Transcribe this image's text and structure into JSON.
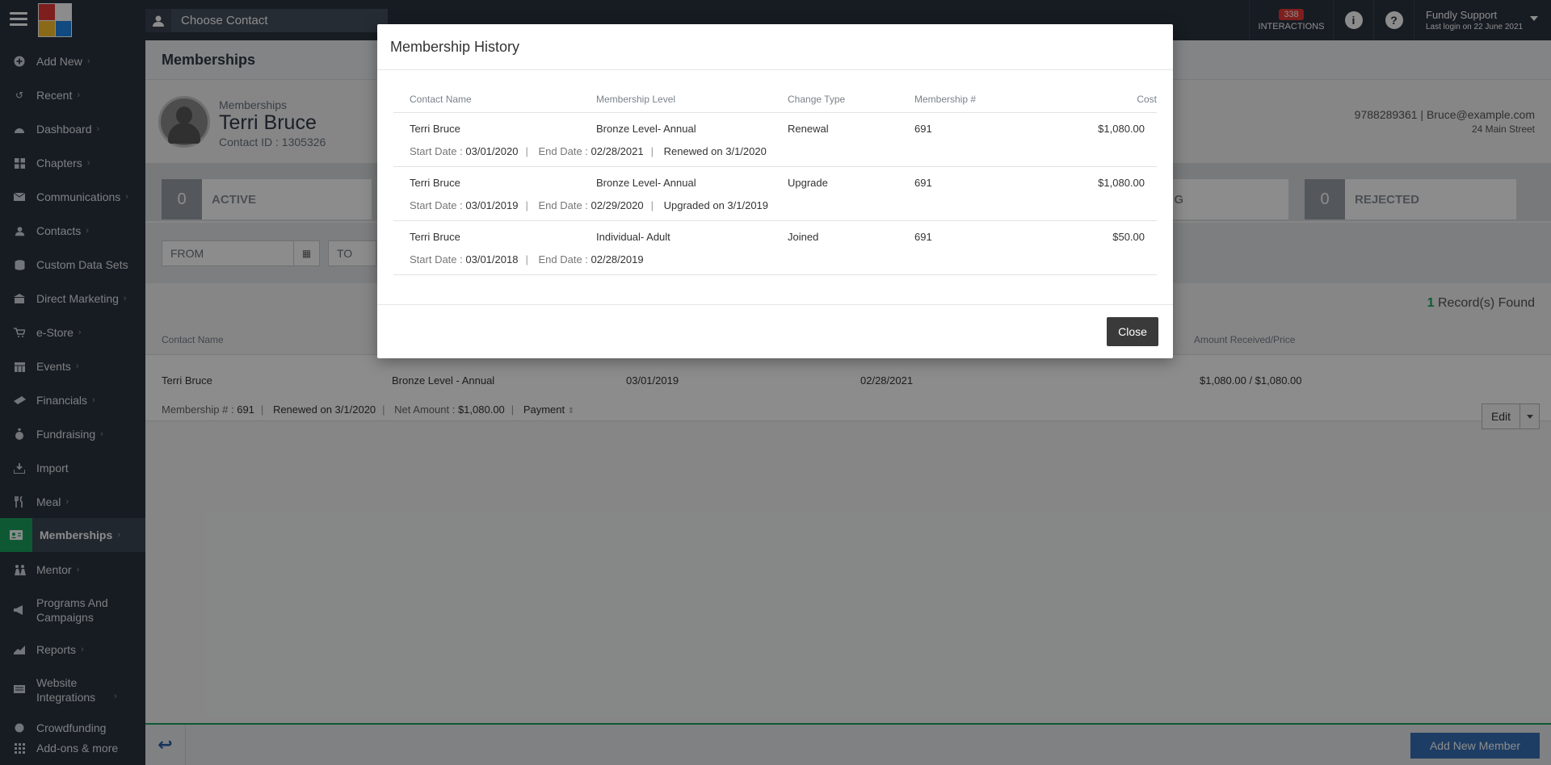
{
  "topbar": {
    "contact_picker_label": "Choose Contact",
    "interactions_count": "338",
    "interactions_label": "INTERACTIONS",
    "user_name": "Fundly Support",
    "last_login": "Last login on 22 June 2021"
  },
  "sidebar": {
    "items": [
      {
        "label": "Add New",
        "icon": "plus-circle-icon"
      },
      {
        "label": "Recent",
        "icon": "history-icon"
      },
      {
        "label": "Dashboard",
        "icon": "dashboard-icon"
      },
      {
        "label": "Chapters",
        "icon": "grid-icon"
      },
      {
        "label": "Communications",
        "icon": "envelope-icon"
      },
      {
        "label": "Contacts",
        "icon": "user-icon"
      },
      {
        "label": "Custom Data Sets",
        "icon": "database-icon"
      },
      {
        "label": "Direct Marketing",
        "icon": "building-icon"
      },
      {
        "label": "e-Store",
        "icon": "cart-icon"
      },
      {
        "label": "Events",
        "icon": "calendar-icon"
      },
      {
        "label": "Financials",
        "icon": "ticket-icon"
      },
      {
        "label": "Fundraising",
        "icon": "money-bag-icon"
      },
      {
        "label": "Import",
        "icon": "download-icon"
      },
      {
        "label": "Meal",
        "icon": "cutlery-icon"
      },
      {
        "label": "Memberships",
        "icon": "id-card-icon"
      },
      {
        "label": "Mentor",
        "icon": "mentor-icon"
      },
      {
        "label": "Programs And Campaigns",
        "icon": "megaphone-icon"
      },
      {
        "label": "Reports",
        "icon": "chart-icon"
      },
      {
        "label": "Website Integrations",
        "icon": "monitor-icon"
      },
      {
        "label": "Crowdfunding",
        "icon": "crowd-icon"
      },
      {
        "label": "Add-ons & more",
        "icon": "apps-icon"
      }
    ]
  },
  "page": {
    "title": "Memberships",
    "profile_sub": "Memberships",
    "profile_name": "Terri Bruce",
    "contact_id": "Contact ID : 1305326",
    "contact_line": "9788289361 | Bruce@example.com",
    "address": "24 Main Street",
    "avatar_text": "NO IMAGE",
    "stats": [
      {
        "count": "0",
        "label": "ACTIVE"
      },
      {
        "count": "",
        "label": "G"
      },
      {
        "count": "0",
        "label": "REJECTED"
      }
    ],
    "from_placeholder": "FROM",
    "to_placeholder": "TO",
    "records_count": "1",
    "records_label": "Record(s) Found",
    "grid_headers": {
      "contact_name": "Contact Name",
      "amount": "Amount Received/Price"
    },
    "row": {
      "contact_name": "Terri Bruce",
      "level": "Bronze Level - Annual",
      "start": "03/01/2019",
      "end": "02/28/2021",
      "amount": "$1,080.00 / $1,080.00",
      "meta_membership_label": "Membership # :",
      "meta_membership_value": "691",
      "meta_renewed": "Renewed on 3/1/2020",
      "meta_net_label": "Net Amount :",
      "meta_net_value": "$1,080.00",
      "meta_payment": "Payment"
    },
    "edit_label": "Edit",
    "add_member_label": "Add New Member"
  },
  "modal": {
    "title": "Membership History",
    "headers": {
      "contact_name": "Contact Name",
      "level": "Membership Level",
      "change_type": "Change Type",
      "membership_no": "Membership #",
      "cost": "Cost"
    },
    "start_label": "Start Date :",
    "end_label": "End Date :",
    "rows": [
      {
        "contact_name": "Terri Bruce",
        "level": "Bronze Level- Annual",
        "change_type": "Renewal",
        "membership_no": "691",
        "cost": "$1,080.00",
        "start": "03/01/2020",
        "end": "02/28/2021",
        "note": "Renewed on 3/1/2020"
      },
      {
        "contact_name": "Terri Bruce",
        "level": "Bronze Level- Annual",
        "change_type": "Upgrade",
        "membership_no": "691",
        "cost": "$1,080.00",
        "start": "03/01/2019",
        "end": "02/29/2020",
        "note": "Upgraded on 3/1/2019"
      },
      {
        "contact_name": "Terri Bruce",
        "level": "Individual- Adult",
        "change_type": "Joined",
        "membership_no": "691",
        "cost": "$50.00",
        "start": "03/01/2018",
        "end": "02/28/2019",
        "note": ""
      }
    ],
    "close_label": "Close"
  },
  "colors": {
    "topbar": "#2b3340",
    "accent_green": "#1aa260",
    "badge_red": "#e53935",
    "primary_blue": "#3770b8",
    "close_button": "#3a3a3a"
  }
}
